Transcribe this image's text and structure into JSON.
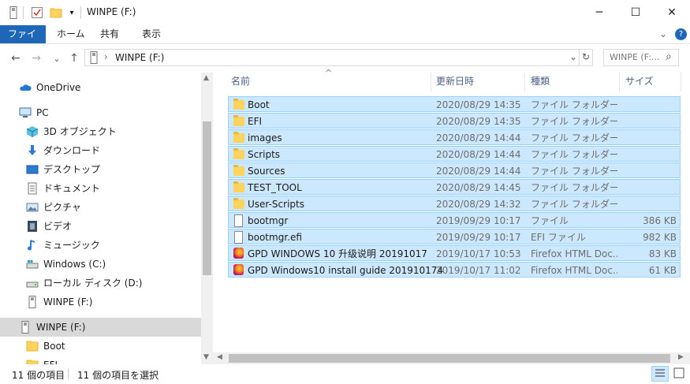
{
  "window": {
    "title": "WINPE (F:)",
    "minimize": "─",
    "maximize": "☐",
    "close": "✕",
    "dropdown": "▾"
  },
  "ribbon": {
    "tabs": [
      "ファイル",
      "ホーム",
      "共有",
      "表示"
    ],
    "expand": "⌄",
    "help": "?"
  },
  "nav": {
    "back": "←",
    "forward": "→",
    "recent": "⌄",
    "up": "↑",
    "address_sep": "›",
    "address": "WINPE (F:)",
    "address_dropdown": "⌄",
    "refresh": "↻",
    "search_placeholder": "WINPE (F:...",
    "search_icon": "⌕"
  },
  "sidebar": {
    "items": [
      {
        "label": "OneDrive",
        "icon": "cloud-icon"
      },
      {
        "label": "PC",
        "icon": "pc-icon"
      },
      {
        "label": "3D オブジェクト",
        "icon": "cube-icon"
      },
      {
        "label": "ダウンロード",
        "icon": "download-icon"
      },
      {
        "label": "デスクトップ",
        "icon": "desktop-icon"
      },
      {
        "label": "ドキュメント",
        "icon": "document-icon"
      },
      {
        "label": "ピクチャ",
        "icon": "picture-icon"
      },
      {
        "label": "ビデオ",
        "icon": "video-icon"
      },
      {
        "label": "ミュージック",
        "icon": "music-icon"
      },
      {
        "label": "Windows (C:)",
        "icon": "drive-icon"
      },
      {
        "label": "ローカル ディスク (D:)",
        "icon": "drive-icon"
      },
      {
        "label": "WINPE (F:)",
        "icon": "usb-drive-icon"
      },
      {
        "label": "WINPE (F:)",
        "icon": "usb-drive-icon"
      },
      {
        "label": "Boot",
        "icon": "folder-icon"
      },
      {
        "label": "EFI",
        "icon": "folder-icon"
      }
    ]
  },
  "columns": {
    "name": "名前",
    "date": "更新日時",
    "type": "種類",
    "size": "サイズ",
    "sort_indicator": "^"
  },
  "files": [
    {
      "name": "Boot",
      "date": "2020/08/29 14:35",
      "type": "ファイル フォルダー",
      "size": "",
      "kind": "folder"
    },
    {
      "name": "EFI",
      "date": "2020/08/29 14:35",
      "type": "ファイル フォルダー",
      "size": "",
      "kind": "folder"
    },
    {
      "name": "images",
      "date": "2020/08/29 14:44",
      "type": "ファイル フォルダー",
      "size": "",
      "kind": "folder"
    },
    {
      "name": "Scripts",
      "date": "2020/08/29 14:44",
      "type": "ファイル フォルダー",
      "size": "",
      "kind": "folder"
    },
    {
      "name": "Sources",
      "date": "2020/08/29 14:44",
      "type": "ファイル フォルダー",
      "size": "",
      "kind": "folder"
    },
    {
      "name": "TEST_TOOL",
      "date": "2020/08/29 14:45",
      "type": "ファイル フォルダー",
      "size": "",
      "kind": "folder"
    },
    {
      "name": "User-Scripts",
      "date": "2020/08/29 14:32",
      "type": "ファイル フォルダー",
      "size": "",
      "kind": "folder"
    },
    {
      "name": "bootmgr",
      "date": "2019/09/29 10:17",
      "type": "ファイル",
      "size": "386 KB",
      "kind": "doc"
    },
    {
      "name": "bootmgr.efi",
      "date": "2019/09/29 10:17",
      "type": "EFI ファイル",
      "size": "982 KB",
      "kind": "doc"
    },
    {
      "name": "GPD  WINDOWS 10 升级说明 20191017",
      "date": "2019/10/17 10:53",
      "type": "Firefox HTML Doc...",
      "size": "83 KB",
      "kind": "firefox"
    },
    {
      "name": "GPD Windows10 install guide 201910174",
      "date": "2019/10/17 11:02",
      "type": "Firefox HTML Doc...",
      "size": "61 KB",
      "kind": "firefox"
    }
  ],
  "status": {
    "count": "11 個の項目",
    "selected": "11 個の項目を選択"
  },
  "colors": {
    "accent": "#1e66b8",
    "selection": "#cce8ff",
    "selection_border": "#99d1ff",
    "folder": "#ffd35c"
  }
}
